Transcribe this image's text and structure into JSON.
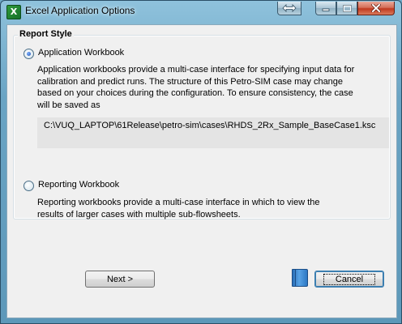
{
  "window": {
    "title": "Excel Application Options"
  },
  "group": {
    "legend": "Report Style"
  },
  "options": [
    {
      "label": "Application Workbook",
      "selected": true,
      "description": [
        "Application workbooks provide a multi-case interface for specifying input data for",
        "calibration and predict runs.  The structure of this Petro-SIM case may change",
        "based on your choices during the configuration.  To ensure consistency, the case",
        "will be saved as"
      ],
      "path": "C:\\VUQ_LAPTOP\\61Release\\petro-sim\\cases\\RHDS_2Rx_Sample_BaseCase1.ksc"
    },
    {
      "label": "Reporting Workbook",
      "selected": false,
      "description": [
        "Reporting workbooks provide a multi-case interface in which to view the",
        "results of larger cases with multiple sub-flowsheets."
      ]
    }
  ],
  "buttons": {
    "next": "Next >",
    "cancel": "Cancel"
  },
  "icons": {
    "app": "excel-app-icon",
    "help": "help-book-icon",
    "move": "move-arrows-icon",
    "minimize": "minimize-icon",
    "maximize": "maximize-icon",
    "close": "close-icon"
  },
  "colors": {
    "title_bar": "#6aa4c4",
    "close_button": "#c0391f",
    "body": "#f0f0f0",
    "path_box": "#e4e4e4",
    "help_icon": "#2d78c4"
  }
}
